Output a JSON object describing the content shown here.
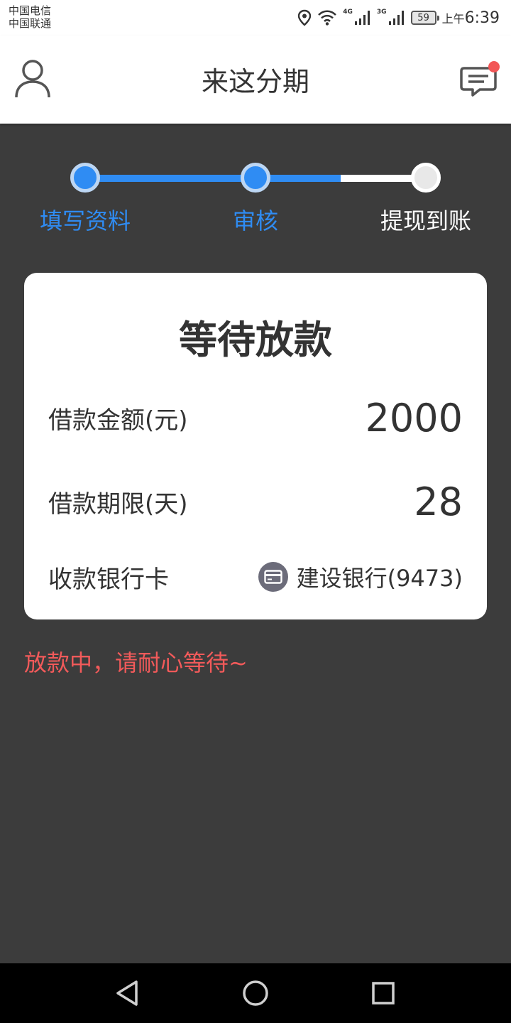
{
  "status_bar": {
    "carrier_1": "中国电信",
    "carrier_2": "中国联通",
    "net_1": "4G",
    "net_2": "3G",
    "battery": "59",
    "time_prefix": "上午",
    "time": "6:39"
  },
  "header": {
    "title": "来这分期",
    "has_unread": true
  },
  "steps": [
    {
      "label": "填写资料",
      "state": "done"
    },
    {
      "label": "审核",
      "state": "current"
    },
    {
      "label": "提现到账",
      "state": "pending"
    }
  ],
  "card": {
    "title": "等待放款",
    "amount_label": "借款金额(元)",
    "amount_value": "2000",
    "term_label": "借款期限(天)",
    "term_value": "28",
    "bank_label": "收款银行卡",
    "bank_value": "建设银行(9473)"
  },
  "notice": "放款中，请耐心等待~",
  "colors": {
    "accent": "#2f8cf3",
    "background": "#3c3c3c",
    "notice": "#f25a5a",
    "badge": "#f25757"
  },
  "icons": {
    "user": "user-icon",
    "message": "message-icon",
    "bank_card": "bank-card-icon",
    "back": "back-icon",
    "home": "home-icon",
    "recent": "recent-apps-icon"
  }
}
